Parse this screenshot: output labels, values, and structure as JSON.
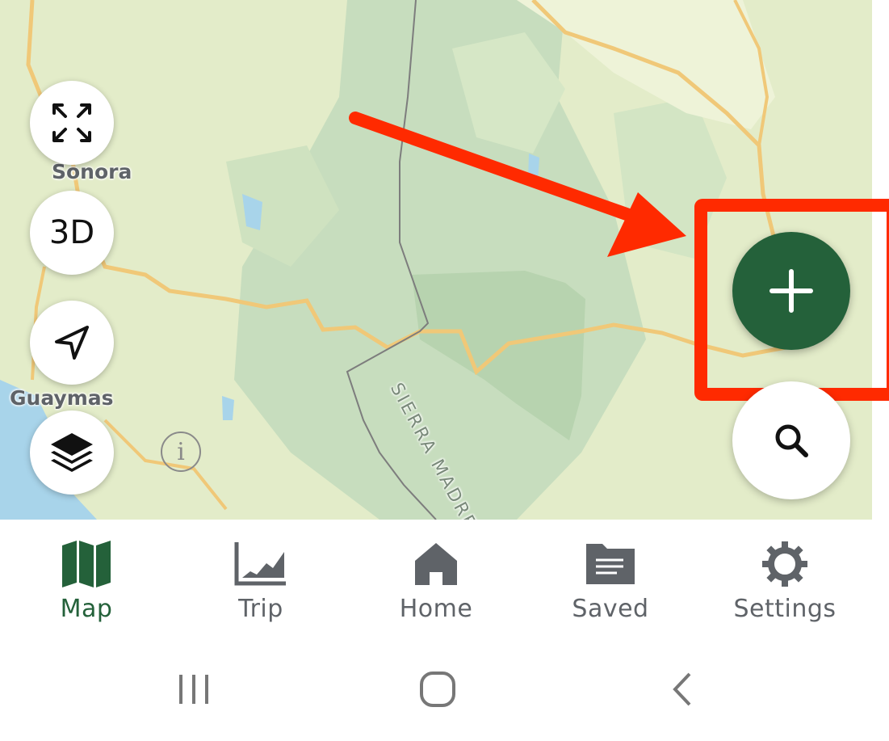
{
  "map": {
    "labels": {
      "sonora": "Sonora",
      "guaymas": "Guaymas",
      "range": "SIERRA MADRE OC"
    },
    "controls": {
      "fullscreen_icon": "expand-icon",
      "three_d_label": "3D",
      "locate_icon": "navigation-arrow-icon",
      "layers_icon": "layers-icon",
      "info_glyph": "i",
      "add_icon": "plus-icon",
      "search_icon": "search-icon"
    },
    "annotation": {
      "arrow_color": "#ff2a00",
      "box_color": "#ff2a00"
    }
  },
  "bottom_nav": {
    "items": [
      {
        "label": "Map",
        "icon": "map-icon",
        "active": true
      },
      {
        "label": "Trip",
        "icon": "chart-icon",
        "active": false
      },
      {
        "label": "Home",
        "icon": "home-icon",
        "active": false
      },
      {
        "label": "Saved",
        "icon": "folder-icon",
        "active": false
      },
      {
        "label": "Settings",
        "icon": "gear-icon",
        "active": false
      }
    ],
    "active_color": "#24613a",
    "inactive_color": "#5f6368"
  },
  "system_nav": {
    "recents_icon": "recents-icon",
    "home_icon": "home-circle-icon",
    "back_icon": "back-chevron-icon"
  }
}
